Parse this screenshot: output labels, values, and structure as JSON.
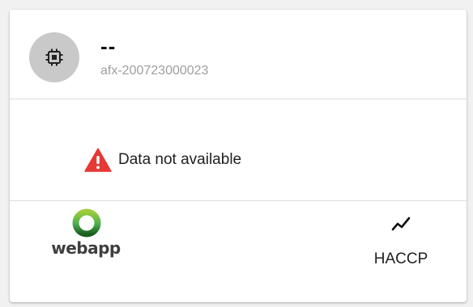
{
  "device": {
    "name": "--",
    "serial": "afx-200723000023",
    "icon": "chip-icon"
  },
  "status": {
    "icon": "warning-icon",
    "text": "Data not available",
    "color": "#e53935"
  },
  "footer": {
    "brand": {
      "text": "webapp",
      "ring_color_top": "#8bc34a",
      "ring_color_bottom": "#1b5e20"
    },
    "chart_link": {
      "icon": "trending-icon",
      "label": "HACCP"
    }
  },
  "colors": {
    "avatar_bg": "#c9c9c9",
    "subtitle": "#9e9e9e",
    "divider": "#dcdcdc"
  }
}
